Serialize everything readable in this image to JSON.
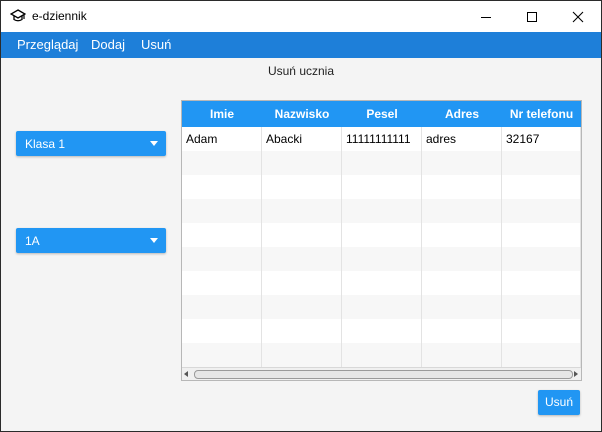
{
  "window": {
    "title": "e-dziennik",
    "app_icon": "graduation-cap-icon"
  },
  "menu": {
    "items": [
      "Przeglądaj",
      "Dodaj",
      "Usuń"
    ]
  },
  "page": {
    "title": "Usuń ucznia"
  },
  "combo_class": {
    "value": "Klasa 1"
  },
  "combo_section": {
    "value": "1A"
  },
  "table": {
    "columns": [
      "Imie",
      "Nazwisko",
      "Pesel",
      "Adres",
      "Nr telefonu"
    ],
    "rows": [
      [
        "Adam",
        "Abacki",
        "11111111111",
        "adres",
        "32167"
      ]
    ]
  },
  "actions": {
    "delete_label": "Usuń"
  },
  "colors": {
    "accent": "#2196f3",
    "menubar": "#1e7fd9"
  }
}
